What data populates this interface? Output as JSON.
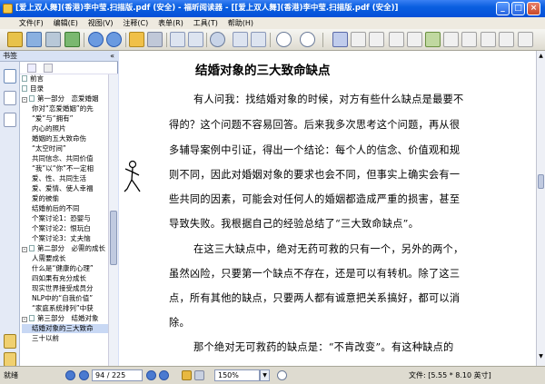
{
  "window": {
    "title": "[爱上双人舞](香港)李中莹.扫描版.pdf (安全) - 福昕阅读器 - [[爱上双人舞](香港)李中莹.扫描版.pdf (安全)]"
  },
  "menu": [
    "文件(F)",
    "编辑(E)",
    "视图(V)",
    "注释(C)",
    "表单(R)",
    "工具(T)",
    "帮助(H)"
  ],
  "sidebar": {
    "title": "书签",
    "items": [
      "前言",
      "目录",
      "第一部分　恋爱婚姻",
      "你对“恋爱婚姻”的先",
      "“爱”与“拥有”",
      "内心的照片",
      "婚姻的五大致命伤",
      "“太空时间”",
      "共同信念、共同价值",
      "“我”以“你”不一定相",
      "爱、性、共同生活",
      "爱、爱情、使人幸福",
      "爱的被偷",
      "结婚前后的不同",
      "个案讨论1：恐婴与",
      "个案讨论2：恨玩白",
      "个案讨论3：丈夫恼",
      "第二部分　必需的成长",
      "人需要成长",
      "什么是“健康的心理”",
      "四如果有充分成长",
      "现实世界接受成员分",
      "NLP中的“自我价值”",
      "“家庭系统排列”中获",
      "第三部分　结婚对象",
      "结婚对象的三大致命",
      "三十以前"
    ]
  },
  "document": {
    "title": "结婚对象的三大致命缺点",
    "lines": [
      "有人问我：找结婚对象的时候，对方有些什么缺点是最要不",
      "得的？这个问题不容易回答。后来我多次思考这个问题，再从很",
      "多辅导案例中引证，得出一个结论：每个人的信念、价值观和规",
      "则不同，因此对婚姻对象的要求也会不同，但事实上确实会有一",
      "些共同的因素，可能会对任何人的婚姻都造成严重的损害，甚至",
      "导致失败。我根据自己的经验总结了“三大致命缺点”。",
      "在这三大缺点中，绝对无药可救的只有一个，另外的两个，",
      "虽然凶险，只要第一个缺点不存在，还是可以有转机。除了这三",
      "点，所有其他的缺点，只要两人都有诚意把关系搞好，都可以消",
      "除。",
      "那个绝对无可救药的缺点是：“不肯改变”。有这种缺点的"
    ]
  },
  "status": {
    "ready": "就绪",
    "page_current": "94 / 225",
    "zoom": "150%",
    "file_size": "文件: [5.55 * 8.10 英寸]"
  }
}
